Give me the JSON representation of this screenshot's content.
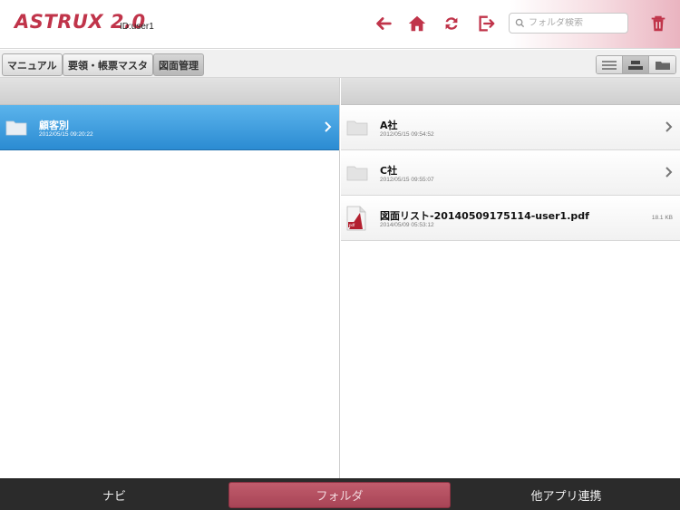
{
  "header": {
    "logo": "ASTRUX 2.0",
    "user_id": "ID:user1",
    "search_placeholder": "フォルダ検索",
    "icons": [
      "back-arrow-icon",
      "home-icon",
      "sync-icon",
      "logout-icon",
      "trash-icon"
    ],
    "accent_color": "#c0344a"
  },
  "tabs": [
    {
      "label": "マニュアル",
      "active": false
    },
    {
      "label": "要領・帳票マスタ",
      "active": false
    },
    {
      "label": "図面管理",
      "active": true
    }
  ],
  "view_modes": [
    "list-view-icon",
    "split-view-icon",
    "folder-view-icon"
  ],
  "left_pane": {
    "items": [
      {
        "name": "顧客別",
        "date": "2012/05/15 09:20:22",
        "type": "folder",
        "selected": true
      }
    ]
  },
  "right_pane": {
    "items": [
      {
        "name": "A社",
        "date": "2012/05/15 09:54:52",
        "type": "folder"
      },
      {
        "name": "C社",
        "date": "2012/05/15 09:55:07",
        "type": "folder"
      },
      {
        "name": "図面リスト-20140509175114-user1.pdf",
        "date": "2014/05/09 05:53:12",
        "type": "pdf",
        "size": "18.1 KB"
      }
    ]
  },
  "bottom_nav": [
    {
      "label": "ナビ",
      "active": false
    },
    {
      "label": "フォルダ",
      "active": true
    },
    {
      "label": "他アプリ連携",
      "active": false
    }
  ]
}
